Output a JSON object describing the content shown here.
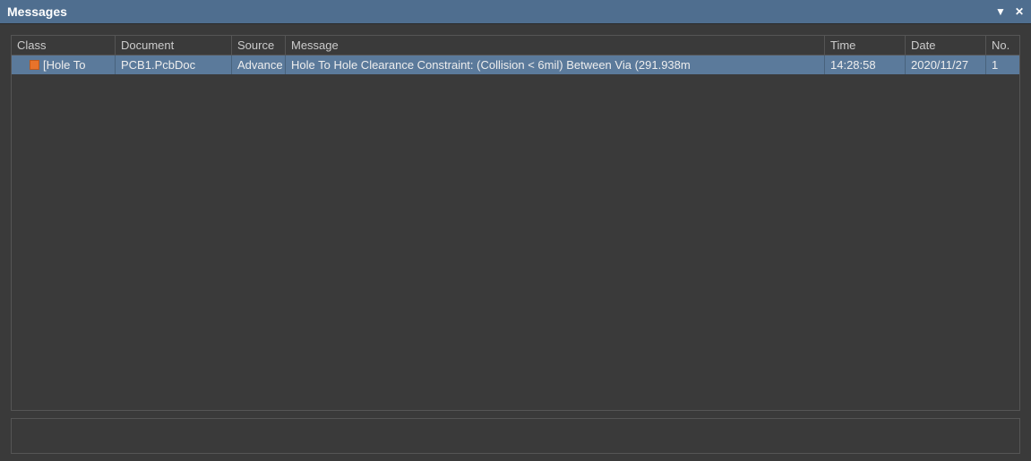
{
  "panel": {
    "title": "Messages"
  },
  "columns": {
    "class": "Class",
    "document": "Document",
    "source": "Source",
    "message": "Message",
    "time": "Time",
    "date": "Date",
    "no": "No."
  },
  "rows": [
    {
      "class": "[Hole To",
      "document": "PCB1.PcbDoc",
      "source": "Advance",
      "message": "Hole To Hole Clearance Constraint: (Collision < 6mil) Between Via (291.938m",
      "time": "14:28:58",
      "date": "2020/11/27",
      "no": "1"
    }
  ]
}
